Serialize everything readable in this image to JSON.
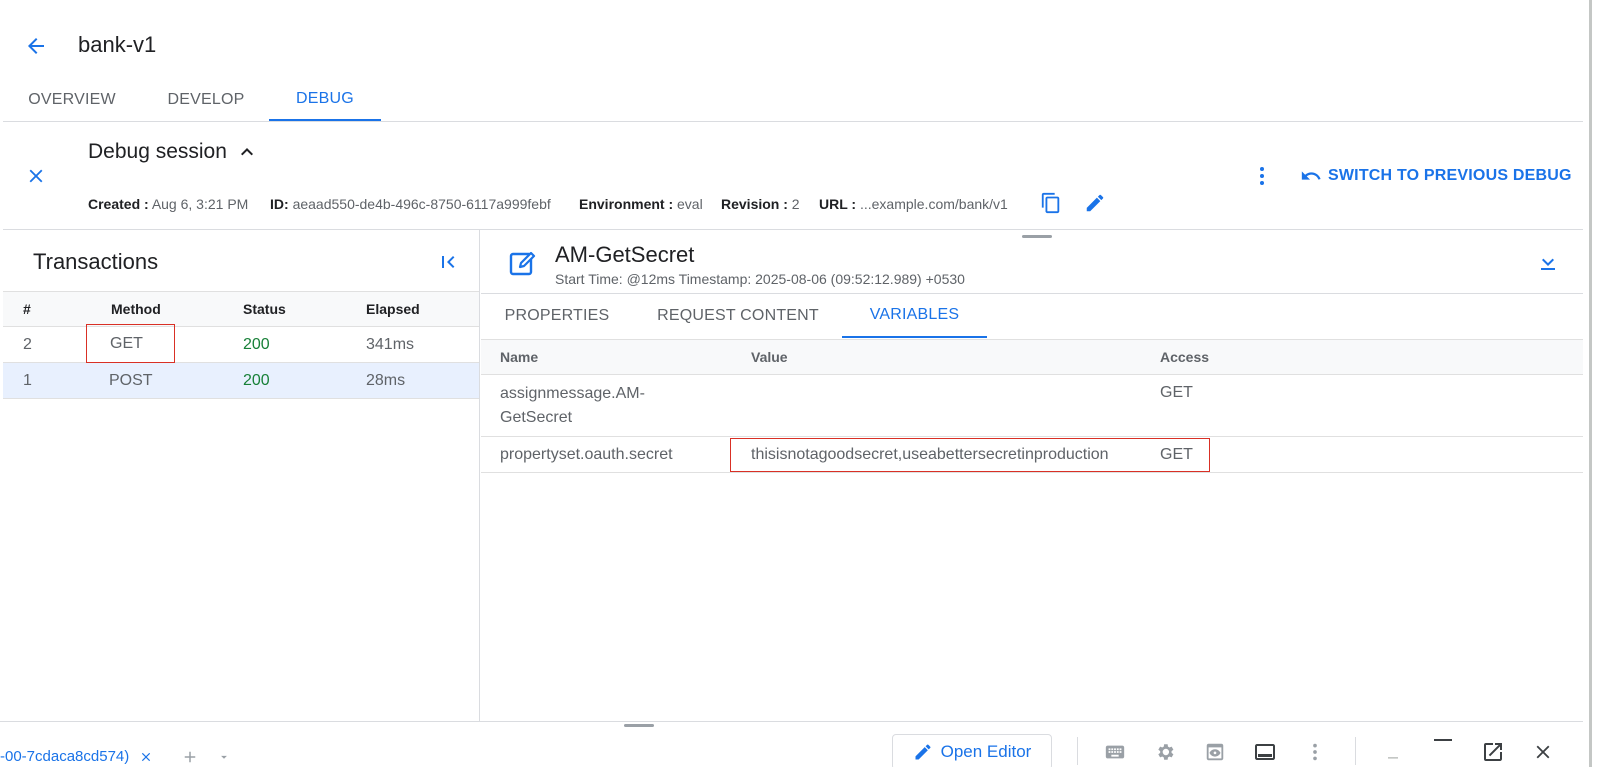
{
  "header": {
    "title": "bank-v1"
  },
  "top_tabs": [
    {
      "label": "OVERVIEW"
    },
    {
      "label": "DEVELOP"
    },
    {
      "label": "DEBUG",
      "active": true
    }
  ],
  "session": {
    "title": "Debug session",
    "created_label": "Created :",
    "created_value": "Aug 6, 3:21 PM",
    "id_label": "ID:",
    "id_value": "aeaad550-de4b-496c-8750-6117a999febf",
    "env_label": "Environment :",
    "env_value": "eval",
    "rev_label": "Revision :",
    "rev_value": "2",
    "url_label": "URL :",
    "url_value": "...example.com/bank/v1",
    "switch_label": "SWITCH TO PREVIOUS DEBUG"
  },
  "transactions": {
    "title": "Transactions",
    "columns": [
      "#",
      "Method",
      "Status",
      "Elapsed"
    ],
    "rows": [
      {
        "num": "2",
        "method": "GET",
        "status": "200",
        "elapsed": "341ms"
      },
      {
        "num": "1",
        "method": "POST",
        "status": "200",
        "elapsed": "28ms"
      }
    ]
  },
  "policy": {
    "name": "AM-GetSecret",
    "meta": "Start Time: @12ms Timestamp: 2025-08-06 (09:52:12.989) +0530",
    "tabs": [
      "PROPERTIES",
      "REQUEST CONTENT",
      "VARIABLES"
    ],
    "columns": [
      "Name",
      "Value",
      "Access"
    ],
    "rows": [
      {
        "name": "assignmessage.AM-\nGetSecret",
        "value": "",
        "access": "GET"
      },
      {
        "name": "propertyset.oauth.secret",
        "value": "thisisnotagoodsecret,useabettersecretinproduction",
        "access": "GET"
      }
    ]
  },
  "bottom": {
    "terminal_tab": "-00-7cdaca8cd574)",
    "open_editor": "Open Editor"
  },
  "colors": {
    "accent": "#1a73e8",
    "success": "#188038",
    "highlight": "#d93025"
  }
}
